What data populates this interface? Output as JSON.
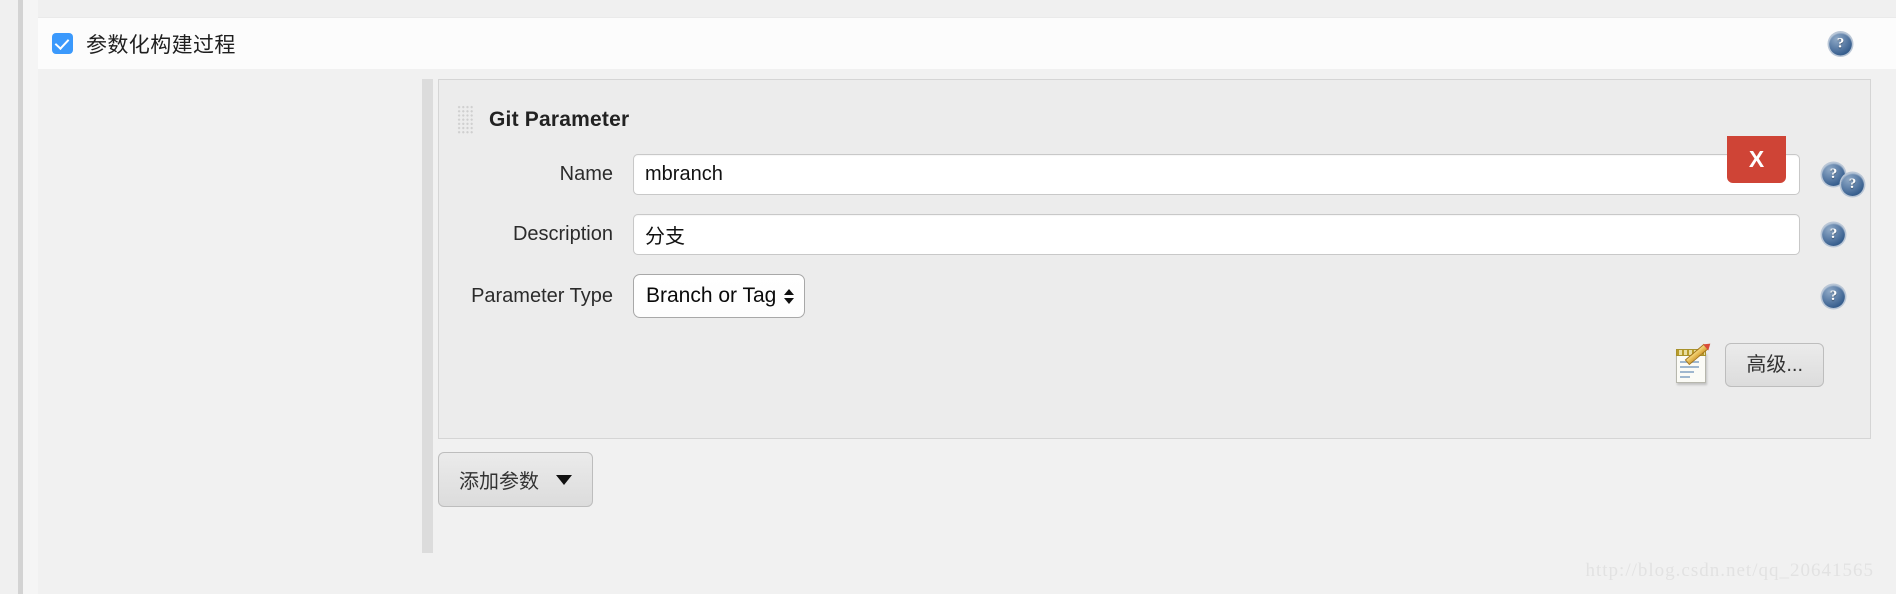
{
  "section": {
    "checkbox_checked": true,
    "title": "参数化构建过程",
    "help_icon": "help-icon",
    "help_glyph": "?"
  },
  "parameter_block": {
    "drag_handle_icon": "drag-handle-icon",
    "title": "Git Parameter",
    "delete_label": "X",
    "fields": [
      {
        "label": "Name",
        "value": "mbranch",
        "help_glyph": "?"
      },
      {
        "label": "Description",
        "value": "分支",
        "help_glyph": "?"
      }
    ],
    "parameter_type": {
      "label": "Parameter Type",
      "selected": "Branch or Tag",
      "help_glyph": "?"
    },
    "advanced": {
      "icon": "notepad-pencil-icon",
      "button_label": "高级..."
    }
  },
  "footer": {
    "add_parameter_label": "添加参数",
    "caret_icon": "caret-down-icon"
  },
  "watermark": "http://blog.csdn.net/qq_20641565",
  "colors": {
    "checkbox_blue": "#3b99fc",
    "delete_red": "#cf4436",
    "panel_bg": "#ececec",
    "body_bg": "#f1f1f1"
  }
}
